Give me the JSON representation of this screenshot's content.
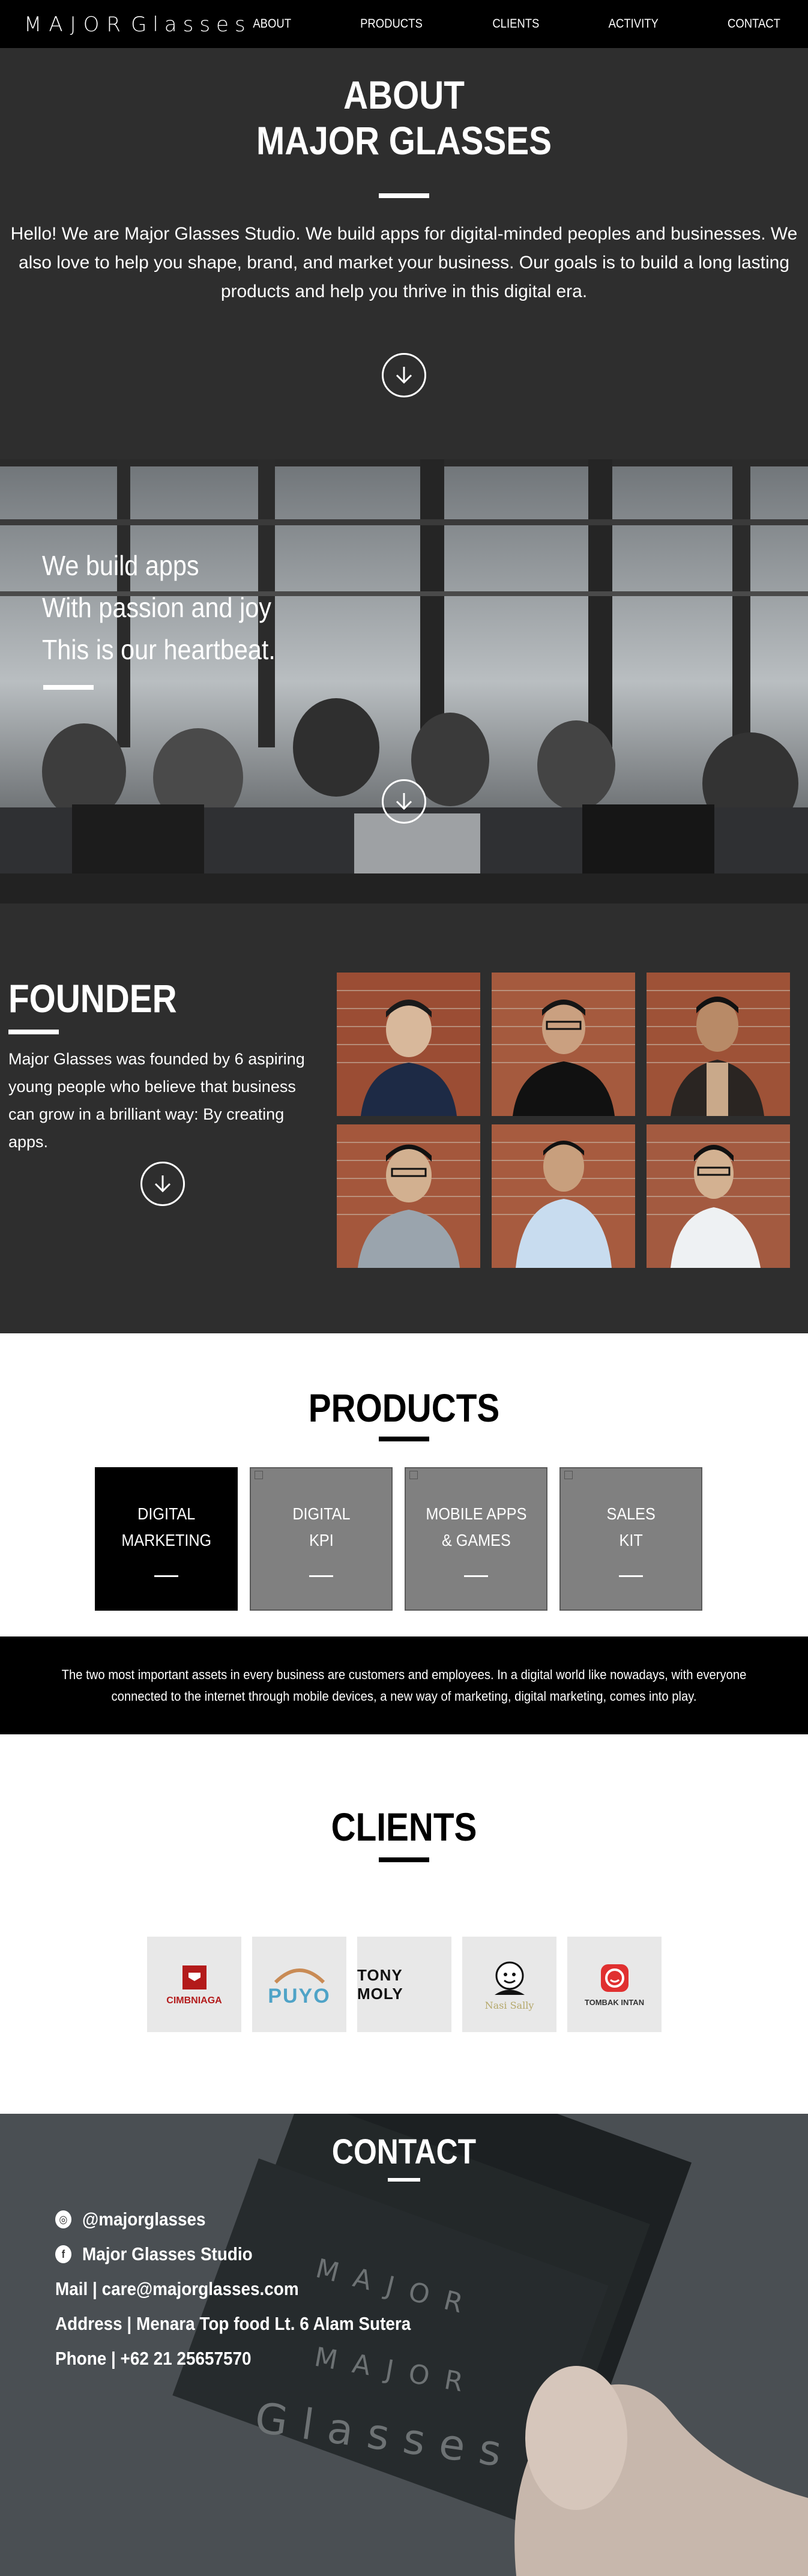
{
  "nav": {
    "logo": "MAJOR Glasses",
    "links": [
      "ABOUT",
      "PRODUCTS",
      "CLIENTS",
      "ACTIVITY",
      "CONTACT"
    ]
  },
  "about": {
    "title_line1": "ABOUT",
    "title_line2": "MAJOR GLASSES",
    "text": "Hello! We are Major Glasses Studio. We build apps for digital-minded peoples and businesses. We also love to help you shape, brand, and market your business. Our goals is to build a long lasting products and help you thrive in this digital era."
  },
  "hero": {
    "line1": "We build apps",
    "line2": "With passion and joy",
    "line3": "This is our heartbeat."
  },
  "founder": {
    "title": "FOUNDER",
    "text": "Major Glasses was founded by 6 aspiring young people who believe that business can grow in a brilliant way: By creating apps."
  },
  "products": {
    "title": "PRODUCTS",
    "items": [
      {
        "label": "DIGITAL\nMARKETING",
        "active": true
      },
      {
        "label": "DIGITAL\nKPI",
        "active": false
      },
      {
        "label": "MOBILE APPS\n& GAMES",
        "active": false
      },
      {
        "label": "SALES\nKIT",
        "active": false
      }
    ],
    "description": "The two most important assets in every business are customers and employees. In a digital world like nowadays, with everyone connected to the internet through mobile devices, a new way of marketing, digital marketing, comes into play."
  },
  "clients": {
    "title": "CLIENTS",
    "logos": [
      {
        "name": "CIMB NIAGA",
        "text": "CIMBNIAGA",
        "color": "#b31b1b"
      },
      {
        "name": "PUYO",
        "text": "PUYO",
        "color": "#4fa3c7"
      },
      {
        "name": "TONY MOLY",
        "text": "TONY MOLY",
        "color": "#111111"
      },
      {
        "name": "Nasi Sally",
        "text": "Nasi Sally",
        "color": "#111111"
      },
      {
        "name": "TOMBAK INTAN",
        "text": "TOMBAK INTAN",
        "color": "#e03030"
      }
    ]
  },
  "contact": {
    "title": "CONTACT",
    "instagram": "@majorglasses",
    "facebook": "Major Glasses Studio",
    "mail": "Mail | care@majorglasses.com",
    "address": "Address | Menara Top food Lt. 6 Alam Sutera",
    "phone": "Phone | +62 21 25657570"
  }
}
